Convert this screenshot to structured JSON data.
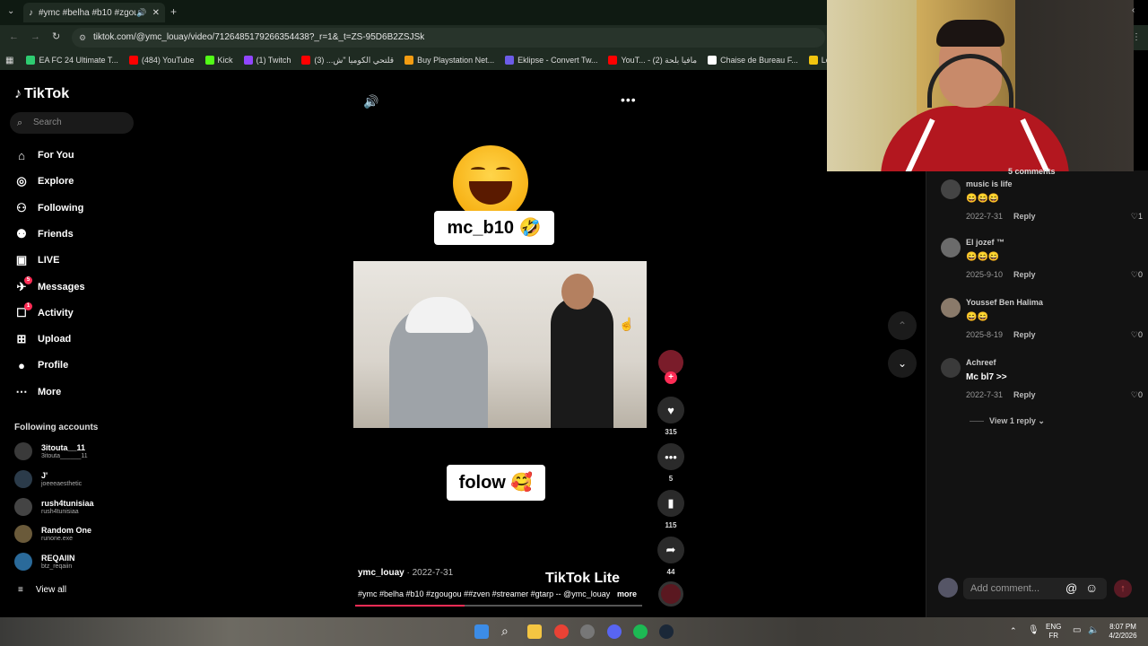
{
  "browser": {
    "tab_title": "#ymc #belha #b10 #zgougou",
    "url": "tiktok.com/@ymc_louay/video/7126485179266354438?_r=1&_t=ZS-95D6B2ZSJSk",
    "bookmarks": [
      {
        "label": "EA FC 24 Ultimate T...",
        "color": "#2ecc71"
      },
      {
        "label": "(484) YouTube",
        "color": "#ff0000"
      },
      {
        "label": "Kick",
        "color": "#53fc18"
      },
      {
        "label": "(1) Twitch",
        "color": "#9146ff"
      },
      {
        "label": "قلتحي الكوميا \"ش... (3)",
        "color": "#ff0000"
      },
      {
        "label": "Buy Playstation Net...",
        "color": "#f39c12"
      },
      {
        "label": "Eklipse - Convert Tw...",
        "color": "#6c5ce7"
      },
      {
        "label": "YouT... - مافيا بلحة (2)",
        "color": "#ff0000"
      },
      {
        "label": "Chaise de Bureau F...",
        "color": "#ffffff"
      },
      {
        "label": "Logitech Brio Strea...",
        "color": "#f1c40f"
      }
    ]
  },
  "sidebar": {
    "logo": "TikTok",
    "search_placeholder": "Search",
    "nav": [
      {
        "label": "For You",
        "icon": "home-icon"
      },
      {
        "label": "Explore",
        "icon": "compass-icon"
      },
      {
        "label": "Following",
        "icon": "user-follow-icon"
      },
      {
        "label": "Friends",
        "icon": "friends-icon"
      },
      {
        "label": "LIVE",
        "icon": "live-icon"
      },
      {
        "label": "Messages",
        "icon": "message-icon",
        "badge": "5"
      },
      {
        "label": "Activity",
        "icon": "activity-icon",
        "badge": "1"
      },
      {
        "label": "Upload",
        "icon": "upload-icon"
      },
      {
        "label": "Profile",
        "icon": "profile-avatar"
      },
      {
        "label": "More",
        "icon": "more-icon"
      }
    ],
    "following_title": "Following accounts",
    "accounts": [
      {
        "name": "3itouta__11",
        "handle": "3itouta______11"
      },
      {
        "name": "J'",
        "handle": "joeeeaesthetic"
      },
      {
        "name": "rush4tunisiaa",
        "handle": "rush4tunisiaa"
      },
      {
        "name": "Random One",
        "handle": "runone.exe"
      },
      {
        "name": "REQAIIN",
        "handle": "btz_reqaiin"
      }
    ],
    "view_all": "View all"
  },
  "video": {
    "sticker_top": "mc_b10 🤣",
    "sticker_bottom": "folow 🥰",
    "author": "ymc_louay",
    "date": " · 2022-7-31",
    "caption": "#ymc #belha #b10 #zgougou  ##zven #streamer #gtarp -- @ymc_louay",
    "more": "more",
    "watermark": "TikTok Lite",
    "progress": 0.38,
    "likes": "315",
    "comments": "5",
    "saves": "115",
    "shares": "44"
  },
  "comments": {
    "count_label": "5 comments",
    "items": [
      {
        "user": "music is life",
        "text": "😄😄😄",
        "date": "2022-7-31",
        "reply": "Reply",
        "likes": "1"
      },
      {
        "user": "El jozef ™",
        "text": "😄😄😄",
        "date": "2025-9-10",
        "reply": "Reply",
        "likes": "0"
      },
      {
        "user": "Youssef Ben Halima",
        "text": "😄😄",
        "date": "2025-8-19",
        "reply": "Reply",
        "likes": "0"
      },
      {
        "user": "Achreef",
        "text": "Mc bl7 >>",
        "date": "2022-7-31",
        "reply": "Reply",
        "likes": "0"
      }
    ],
    "view_reply": "View 1 reply",
    "add_placeholder": "Add comment..."
  },
  "taskbar": {
    "lang_top": "ENG",
    "lang_bottom": "FR",
    "time": "8:07 PM",
    "date": "4/2/2026"
  }
}
